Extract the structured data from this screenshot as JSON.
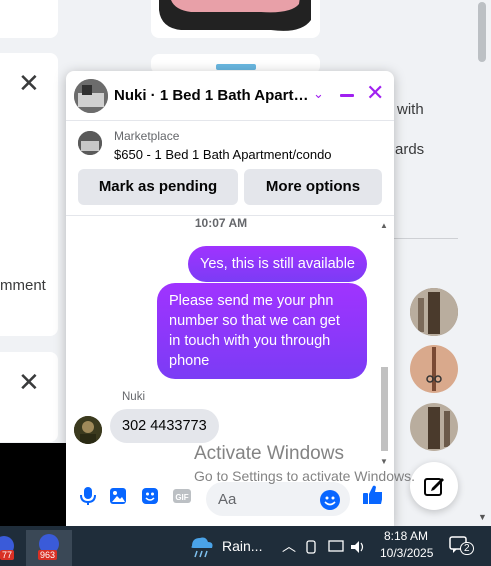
{
  "background": {
    "card_text_with": "with",
    "card_text_ards": "ards",
    "card_text_mment": "mment"
  },
  "chat": {
    "title": "Nuki · 1 Bed 1 Bath Apartm...",
    "marketplace_label": "Marketplace",
    "listing": "$650 - 1 Bed 1 Bath Apartment/condo",
    "mark_pending": "Mark as pending",
    "more_options": "More options",
    "timestamp": "10:07 AM",
    "outgoing": [
      "Yes, this is still available",
      "Please send me your phn number so that we can get in touch with you through phone"
    ],
    "sender_name": "Nuki",
    "incoming": "302 4433773",
    "composer_placeholder": "Aa"
  },
  "watermark": {
    "line1": "Activate Windows",
    "line2": "Go to Settings to activate Windows."
  },
  "taskbar": {
    "badge_a": "77",
    "badge_b": "963",
    "weather": "Rain...",
    "time": "8:18 AM",
    "date": "10/3/2025",
    "notifications": "2"
  },
  "colors": {
    "accent": "#a020f0",
    "bubble_from": "#a033ff",
    "bubble_to": "#7b3cf5",
    "like_blue": "#0866ff"
  }
}
